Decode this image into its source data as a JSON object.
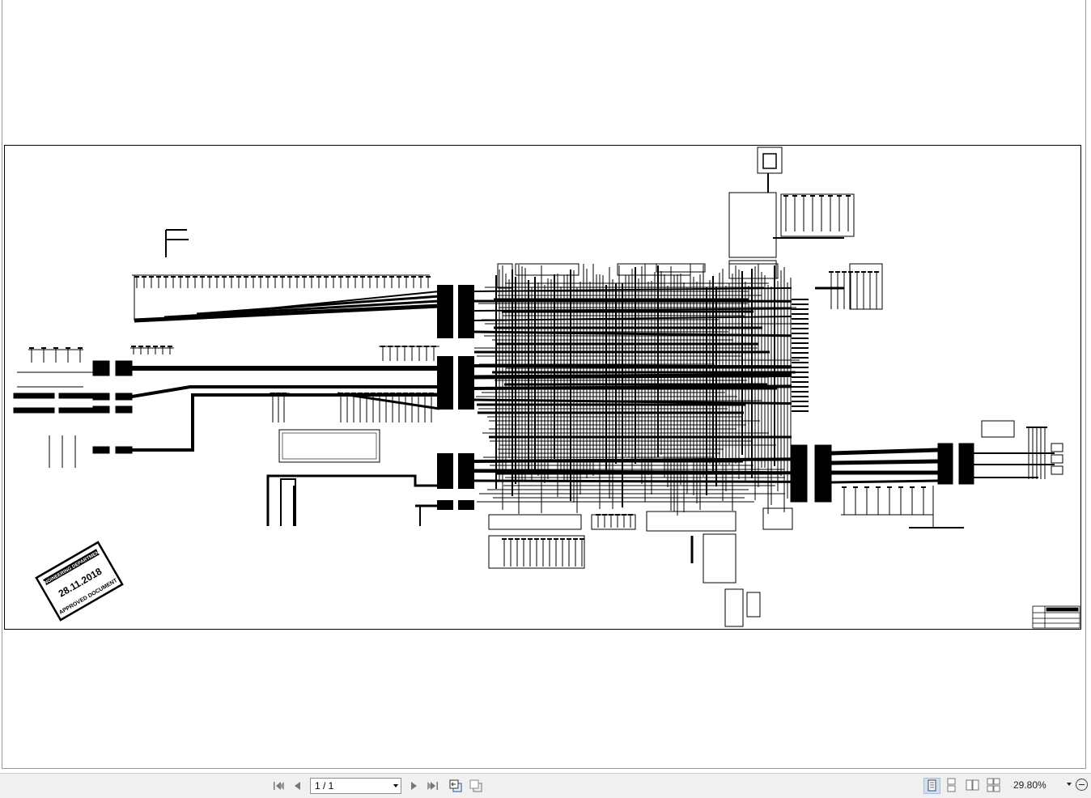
{
  "stamp": {
    "department": "ENGINEERING DEPARTMENT",
    "date": "28.11.2018",
    "status": "APPROVED DOCUMENT"
  },
  "toolbar": {
    "page_indicator": "1 / 1",
    "zoom_level": "29.80%",
    "icons": [
      "first-page-icon",
      "previous-page-icon",
      "next-page-icon",
      "last-page-icon",
      "previous-view-icon",
      "next-view-icon",
      "single-page-icon",
      "continuous-page-icon",
      "facing-pages-icon",
      "continuous-facing-icon",
      "zoom-out-icon"
    ]
  },
  "colors": {
    "ink": "#000000",
    "paper": "#ffffff",
    "statusbar": "#f0f0f0",
    "active_view": "#cde0f5"
  }
}
